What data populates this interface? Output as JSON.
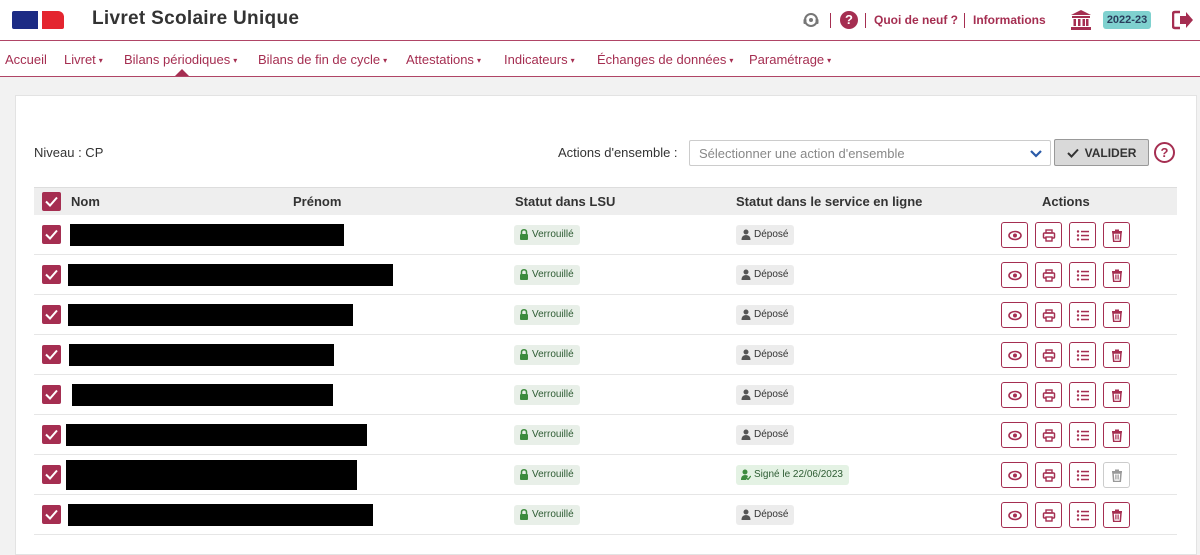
{
  "header": {
    "title": "Livret Scolaire Unique",
    "links": {
      "whats_new": "Quoi de neuf ?",
      "info": "Informations"
    },
    "year": "2022-23",
    "help_glyph": "?"
  },
  "nav": {
    "items": [
      {
        "label": "Accueil",
        "caret": false
      },
      {
        "label": "Livret",
        "caret": true
      },
      {
        "label": "Bilans périodiques",
        "caret": true,
        "active": true
      },
      {
        "label": "Bilans de fin de cycle",
        "caret": true
      },
      {
        "label": "Attestations",
        "caret": true
      },
      {
        "label": "Indicateurs",
        "caret": true
      },
      {
        "label": "Échanges de données",
        "caret": true
      },
      {
        "label": "Paramétrage",
        "caret": true
      }
    ],
    "caret_glyph": "▾"
  },
  "toolbar": {
    "niveau_label": "Niveau : CP",
    "actions_label": "Actions d'ensemble :",
    "select_placeholder": "Sélectionner une action d'ensemble",
    "validate_label": "VALIDER",
    "help_glyph": "?"
  },
  "table": {
    "headers": {
      "nom": "Nom",
      "prenom": "Prénom",
      "statut_lsu": "Statut dans LSU",
      "statut_service": "Statut dans le service en ligne",
      "actions": "Actions"
    },
    "rows": [
      {
        "lsu": "Verrouillé",
        "service": "Déposé",
        "service_type": "depose",
        "delete_enabled": true
      },
      {
        "lsu": "Verrouillé",
        "service": "Déposé",
        "service_type": "depose",
        "delete_enabled": true
      },
      {
        "lsu": "Verrouillé",
        "service": "Déposé",
        "service_type": "depose",
        "delete_enabled": true
      },
      {
        "lsu": "Verrouillé",
        "service": "Déposé",
        "service_type": "depose",
        "delete_enabled": true
      },
      {
        "lsu": "Verrouillé",
        "service": "Déposé",
        "service_type": "depose",
        "delete_enabled": true
      },
      {
        "lsu": "Verrouillé",
        "service": "Déposé",
        "service_type": "depose",
        "delete_enabled": true
      },
      {
        "lsu": "Verrouillé",
        "service": "Signé le 22/06/2023",
        "service_type": "signe",
        "delete_enabled": false
      },
      {
        "lsu": "Verrouillé",
        "service": "Déposé",
        "service_type": "depose",
        "delete_enabled": true
      }
    ]
  },
  "colors": {
    "accent": "#a52e51",
    "badge_year": "#7fd1cf"
  }
}
